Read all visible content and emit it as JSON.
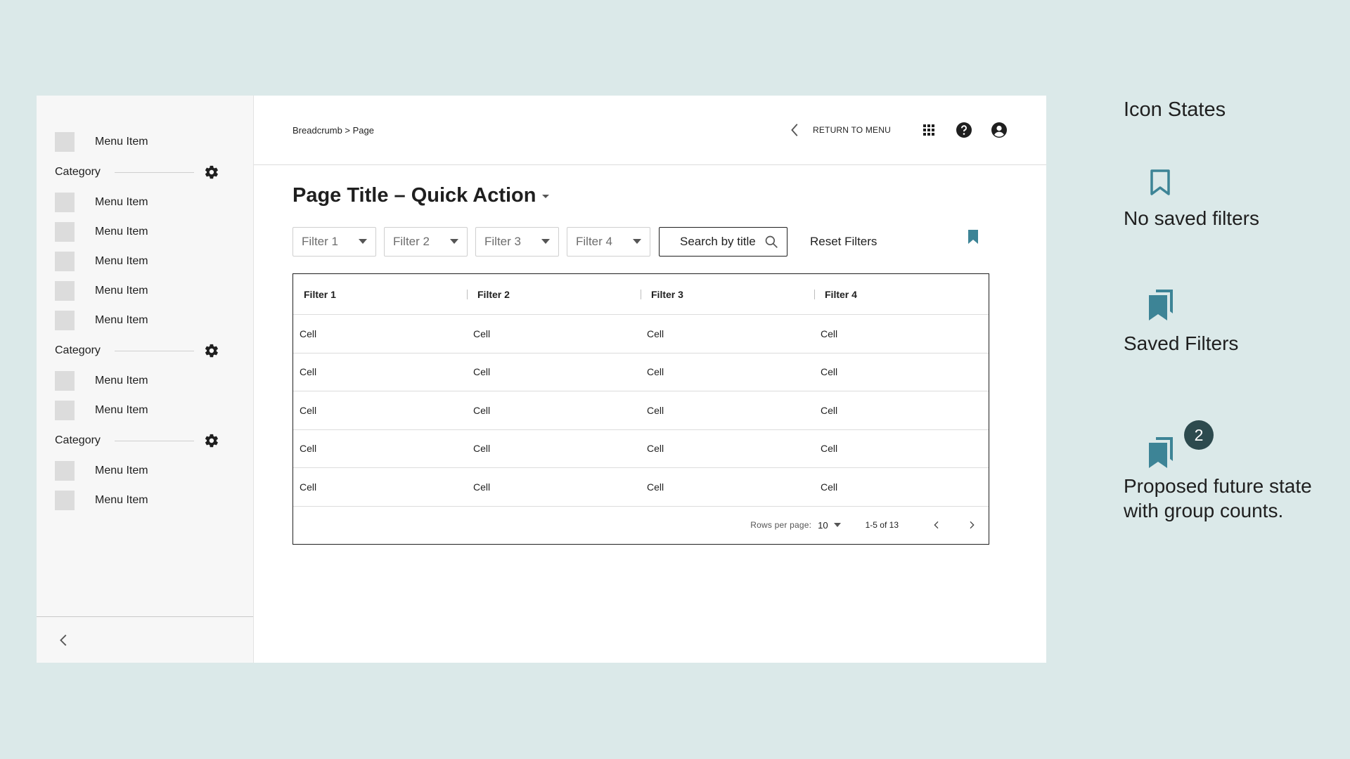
{
  "colors": {
    "background": "#dbe9e9",
    "accent": "#3d8496",
    "badge": "#2d4a4e"
  },
  "sidebar": {
    "sections": [
      {
        "category": null,
        "items": [
          "Menu Item"
        ]
      },
      {
        "category": "Category",
        "items": [
          "Menu Item",
          "Menu Item",
          "Menu Item",
          "Menu Item",
          "Menu Item"
        ]
      },
      {
        "category": "Category",
        "items": [
          "Menu Item",
          "Menu Item"
        ]
      },
      {
        "category": "Category",
        "items": [
          "Menu Item",
          "Menu Item"
        ]
      }
    ],
    "settings_icon": "gear-icon",
    "collapse_icon": "chevron-left-icon"
  },
  "header": {
    "breadcrumb": "Breadcrumb > Page",
    "return_label": "RETURN TO MENU",
    "icons": [
      "chevron-left-icon",
      "apps-grid-icon",
      "help-icon",
      "account-icon"
    ]
  },
  "page": {
    "title": "Page Title – Quick Action"
  },
  "filters": {
    "selects": [
      "Filter 1",
      "Filter 2",
      "Filter 3",
      "Filter 4"
    ],
    "search_placeholder": "Search by title",
    "reset_label": "Reset Filters",
    "bookmark_icon": "bookmark-filled-icon"
  },
  "table": {
    "columns": [
      "Filter 1",
      "Filter 2",
      "Filter 3",
      "Filter 4"
    ],
    "rows": [
      [
        "Cell",
        "Cell",
        "Cell",
        "Cell"
      ],
      [
        "Cell",
        "Cell",
        "Cell",
        "Cell"
      ],
      [
        "Cell",
        "Cell",
        "Cell",
        "Cell"
      ],
      [
        "Cell",
        "Cell",
        "Cell",
        "Cell"
      ],
      [
        "Cell",
        "Cell",
        "Cell",
        "Cell"
      ]
    ],
    "pagination": {
      "rows_per_page_label": "Rows per page:",
      "rows_per_page": "10",
      "range": "1-5 of 13"
    }
  },
  "annotations": {
    "title": "Icon States",
    "states": [
      {
        "label": "No saved filters",
        "icon": "bookmark-outline-icon"
      },
      {
        "label": "Saved Filters",
        "icon": "bookmarks-stacked-icon"
      },
      {
        "label": "Proposed future state with group counts.",
        "icon": "bookmarks-stacked-badge-icon",
        "badge": "2"
      }
    ]
  }
}
